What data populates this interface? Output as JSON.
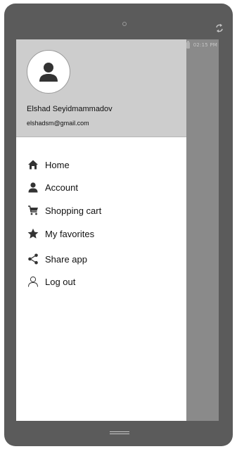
{
  "status_bar": {
    "time": "02:15 PM"
  },
  "user": {
    "name": "Elshad Seyidmammadov",
    "email": "elshadsm@gmail.com"
  },
  "menu": {
    "items": [
      {
        "label": "Home",
        "icon": "home-icon"
      },
      {
        "label": "Account",
        "icon": "account-icon"
      },
      {
        "label": "Shopping cart",
        "icon": "cart-icon"
      },
      {
        "label": "My favorites",
        "icon": "star-icon"
      },
      {
        "label": "Share app",
        "icon": "share-icon"
      },
      {
        "label": "Log out",
        "icon": "logout-icon"
      }
    ]
  },
  "colors": {
    "device": "#5b5b5b",
    "header": "#cdcdcd",
    "scrim": "#8a8a8a",
    "icon": "#333333"
  }
}
